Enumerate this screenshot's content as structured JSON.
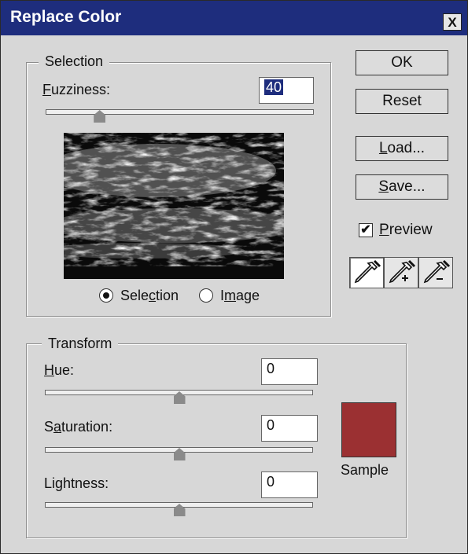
{
  "window": {
    "title": "Replace Color",
    "close_label": "X"
  },
  "selection_group": {
    "legend": "Selection",
    "fuzziness_label": "Fuzziness:",
    "fuzziness_value": "40",
    "fuzziness_level_percent": 20,
    "mode_options": [
      {
        "label": "Selection",
        "selected": true
      },
      {
        "label": "Image",
        "selected": false
      }
    ]
  },
  "buttons": {
    "ok": "OK",
    "reset": "Reset",
    "load": "Load...",
    "save": "Save..."
  },
  "preview": {
    "label": "Preview",
    "checked": true,
    "check_glyph": "✔"
  },
  "tools": [
    "eyedropper-icon",
    "eyedropper-plus-icon",
    "eyedropper-minus-icon"
  ],
  "transform_group": {
    "legend": "Transform",
    "hue_label": "Hue:",
    "hue_value": "0",
    "saturation_label": "Saturation:",
    "saturation_value": "0",
    "lightness_label": "Lightness:",
    "lightness_value": "0",
    "slider_level_percent": 50
  },
  "sample": {
    "label": "Sample",
    "color": "#9b3032"
  }
}
